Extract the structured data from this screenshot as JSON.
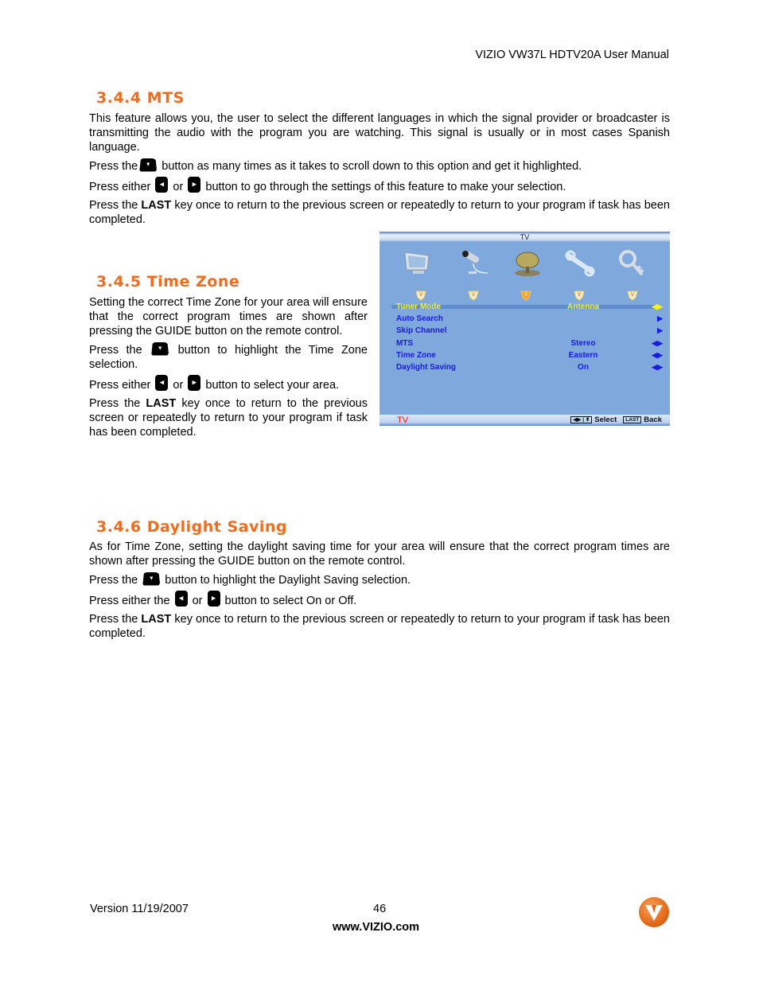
{
  "header": {
    "title": "VIZIO VW37L HDTV20A User Manual"
  },
  "sections": [
    {
      "title": "3.4.4 MTS",
      "intro": "This feature allows you, the user to select the different languages in which the signal provider or broadcaster is transmitting the audio with the program you are watching. This signal is usually or in most cases Spanish language.",
      "step_down_pre": "Press the",
      "step_down_post": " button as many times as it takes to scroll down to this option and get it highlighted.",
      "step_lr_pre": "Press either ",
      "step_lr_or": " or ",
      "step_lr_post": " button to go through the settings of this feature to make your selection.",
      "last_pre": "Press the ",
      "last_key": "LAST",
      "last_post": " key once to return to the previous screen or repeatedly to return to your program if task has been completed."
    },
    {
      "title": "3.4.5 Time Zone",
      "intro": "Setting the correct Time Zone for your area will ensure that the correct program times are shown after pressing the GUIDE button on the remote control.",
      "step_down_pre": "Press the ",
      "step_down_post": "  button to highlight the Time Zone selection.",
      "step_lr_pre": "Press either ",
      "step_lr_or": " or ",
      "step_lr_post": "  button to select your area.",
      "last_pre": "Press the ",
      "last_key": "LAST",
      "last_post": " key once to return to the previous screen or repeatedly to return to your program if task has been completed."
    },
    {
      "title": "3.4.6 Daylight Saving",
      "intro": "As for Time Zone, setting the daylight saving time for your area will ensure that the correct program times are shown after pressing the GUIDE button on the remote control.",
      "step_down_pre": "Press the ",
      "step_down_post": " button to highlight the Daylight Saving selection.",
      "step_lr_pre": "Press either the ",
      "step_lr_or": " or ",
      "step_lr_post": "  button to select On or Off.",
      "last_pre": "Press the ",
      "last_key": "LAST",
      "last_post": " key once to return to the previous screen or repeatedly to return to your program if task has been completed."
    }
  ],
  "osd": {
    "top_title": "TV",
    "icons": [
      "tv-monitor-icon",
      "microphone-icon",
      "satellite-dish-icon",
      "wrench-icon",
      "key-icon"
    ],
    "active_icon_index": 2,
    "rows": [
      {
        "label": "Tuner Mode",
        "value": "Antenna",
        "arrow": "◀▶",
        "selected": true
      },
      {
        "label": "Auto Search",
        "value": "",
        "arrow": "▶",
        "selected": false
      },
      {
        "label": "Skip Channel",
        "value": "",
        "arrow": "▶",
        "selected": false
      },
      {
        "label": "MTS",
        "value": "Stereo",
        "arrow": "◀▶",
        "selected": false
      },
      {
        "label": "Time Zone",
        "value": "Eastern",
        "arrow": "◀▶",
        "selected": false
      },
      {
        "label": "Daylight Saving",
        "value": "On",
        "arrow": "◀▶",
        "selected": false
      }
    ],
    "footer_source": "TV",
    "select_key": "◀▶ | ⬍",
    "select_label": "Select",
    "back_key": "LAST",
    "back_label": "Back"
  },
  "footer": {
    "version": "Version 11/19/2007",
    "page": "46",
    "url": "www.VIZIO.com"
  },
  "colors": {
    "heading": "#f26b1d",
    "osd_bg": "#7fa8dc",
    "osd_text": "#1a1ae0",
    "osd_selected": "#f5f514"
  }
}
